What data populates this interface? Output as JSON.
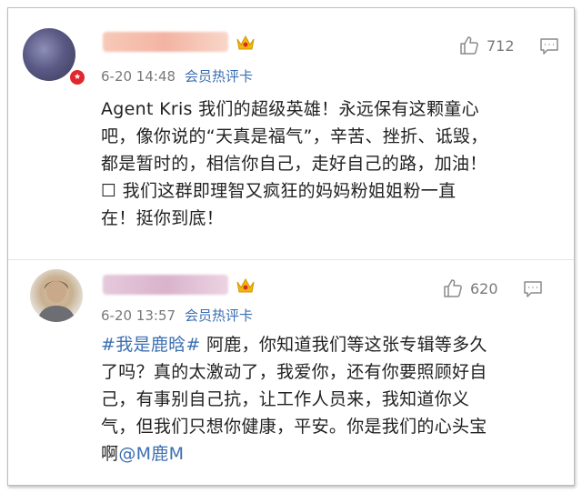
{
  "comments": [
    {
      "date": "6-20 14:48",
      "tag": "会员热评卡",
      "likes": "712",
      "lines": [
        {
          "text": "Agent Kris 我们的超级英雄！永远保有这颗童心"
        },
        {
          "text": "吧，像你说的“天真是福气”，辛苦、挫折、诋毁，"
        },
        {
          "text": "都是暂时的，相信你自己，走好自己的路，加油！"
        },
        {
          "text": "☐ 我们这群即理智又疯狂的妈妈粉姐姐粉一直"
        },
        {
          "text": "在！挺你到底！"
        }
      ]
    },
    {
      "date": "6-20 13:57",
      "tag": "会员热评卡",
      "likes": "620",
      "lines": [
        {
          "prefix": "#我是鹿晗#",
          "text": " 阿鹿，你知道我们等这张专辑等多久"
        },
        {
          "text": "了吗？真的太激动了，我爱你，还有你要照顾好自"
        },
        {
          "text": "己，有事别自己抗，让工作人员来，我知道你义"
        },
        {
          "text": "气，但我们只想你健康，平安。你是我们的心头宝"
        },
        {
          "text": "啊",
          "suffix": "@M鹿M"
        }
      ]
    }
  ],
  "icons": {
    "like": "thumbs-up-icon",
    "reply": "comment-icon",
    "crown": "crown-icon",
    "verified": "verified-badge-icon"
  },
  "colors": {
    "link": "#3c6fb2",
    "meta": "#7a7a7a",
    "crown": "#f2b70b",
    "badge": "#e0272d"
  }
}
